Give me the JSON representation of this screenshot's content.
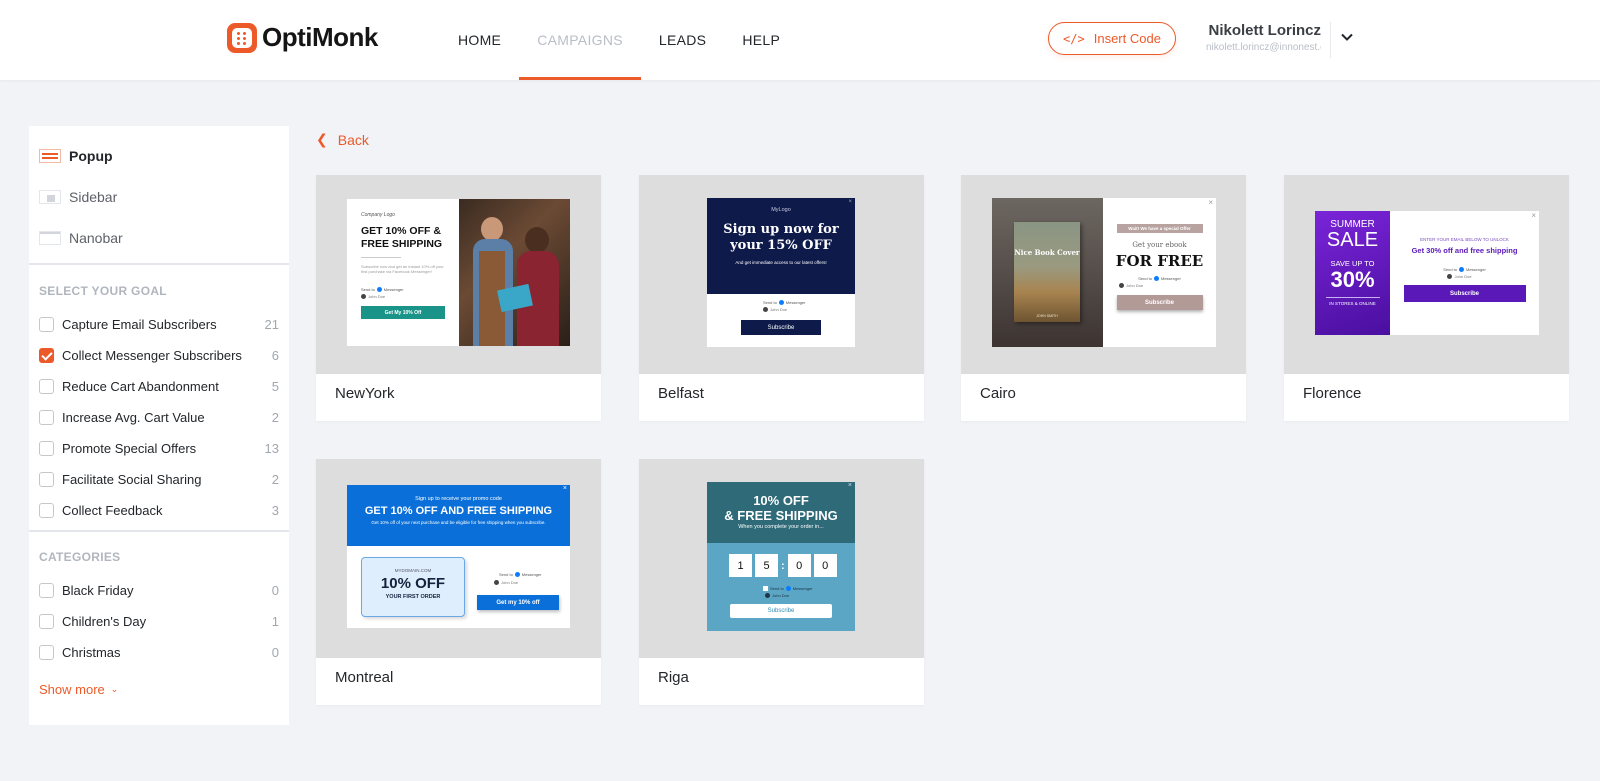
{
  "header": {
    "logo_text": "OptiMonk",
    "nav": [
      {
        "label": "HOME",
        "active": false
      },
      {
        "label": "CAMPAIGNS",
        "active": true
      },
      {
        "label": "LEADS",
        "active": false
      },
      {
        "label": "HELP",
        "active": false
      }
    ],
    "insert_code_label": "Insert Code",
    "user_name": "Nikolett Lorincz",
    "user_email": "nikolett.lorincz@innonest.com"
  },
  "sidebar": {
    "types": [
      {
        "label": "Popup",
        "active": true
      },
      {
        "label": "Sidebar",
        "active": false
      },
      {
        "label": "Nanobar",
        "active": false
      }
    ],
    "goal_title": "SELECT YOUR GOAL",
    "goals": [
      {
        "label": "Capture Email Subscribers",
        "count": "21",
        "checked": false
      },
      {
        "label": "Collect Messenger Subscribers",
        "count": "6",
        "checked": true
      },
      {
        "label": "Reduce Cart Abandonment",
        "count": "5",
        "checked": false
      },
      {
        "label": "Increase Avg. Cart Value",
        "count": "2",
        "checked": false
      },
      {
        "label": "Promote Special Offers",
        "count": "13",
        "checked": false
      },
      {
        "label": "Facilitate Social Sharing",
        "count": "2",
        "checked": false
      },
      {
        "label": "Collect Feedback",
        "count": "3",
        "checked": false
      }
    ],
    "categories_title": "CATEGORIES",
    "categories": [
      {
        "label": "Black Friday",
        "count": "0",
        "checked": false
      },
      {
        "label": "Children's Day",
        "count": "1",
        "checked": false
      },
      {
        "label": "Christmas",
        "count": "0",
        "checked": false
      }
    ],
    "show_more": "Show more"
  },
  "main": {
    "back_label": "Back",
    "templates": [
      {
        "name": "NewYork"
      },
      {
        "name": "Belfast"
      },
      {
        "name": "Cairo"
      },
      {
        "name": "Florence"
      },
      {
        "name": "Montreal"
      },
      {
        "name": "Riga"
      }
    ]
  },
  "previews": {
    "newyork": {
      "logo": "Company Logo",
      "headline": "GET 10% OFF & FREE SHIPPING",
      "body": "Subscribe now and get an instant 10% off your first purchase via Facebook Messenger!",
      "send_to": "Send to",
      "messenger": "Messenger",
      "user": "John Doe",
      "cta": "Get My 10% Off"
    },
    "belfast": {
      "logo": "MyLogo",
      "headline": "Sign up now for your 15% OFF",
      "sub": "And get immediate access to our latest offers!",
      "send_to": "Send to",
      "messenger": "Messenger",
      "user": "John Doe",
      "cta": "Subscribe"
    },
    "cairo": {
      "book_title": "Nice Book Cover",
      "author": "JOHN SMITH",
      "tag": "Wait! We have a special Offer",
      "line1": "Get your ebook",
      "line2": "FOR FREE",
      "send_to": "Send to",
      "messenger": "Messenger",
      "user": "John Doe",
      "cta": "Subscribe"
    },
    "florence": {
      "summer": "SUMMER",
      "sale": "SALE",
      "save": "SAVE UP TO",
      "pct": "30%",
      "stores": "IN STORES & ONLINE",
      "unlock": "ENTER YOUR EMAIL BELOW TO UNLOCK",
      "offer": "Get 30% off and free shipping",
      "send_to": "Send to",
      "messenger": "Messenger",
      "user": "John Doe",
      "cta": "Subscribe"
    },
    "montreal": {
      "top": "Sign up to receive your promo code",
      "headline": "GET 10% OFF AND FREE SHIPPING",
      "sub": "Get 10% off of your next purchase and be eligible for free shipping when you subscribe.",
      "domain": "MYDOMAIN.COM",
      "big": "10% OFF",
      "first": "YOUR FIRST ORDER",
      "send_to": "Send to",
      "messenger": "Messenger",
      "user": "John Doe",
      "cta": "Get my 10% off"
    },
    "riga": {
      "line1": "10% OFF",
      "line2": "& FREE SHIPPING",
      "line3": "When you complete your order in...",
      "d1": "1",
      "d2": "5",
      "d3": "0",
      "d4": "0",
      "send_to": "Send to",
      "messenger": "Messenger",
      "user": "John Doe",
      "cta": "Subscribe"
    }
  },
  "colors": {
    "accent": "#ed5a29",
    "page_bg": "#f1f3f7",
    "belfast_navy": "#0d1a4a",
    "florence_purple": "#5a18b8",
    "montreal_blue": "#0a6fd8",
    "riga_teal": "#2e6a77",
    "newyork_teal": "#1a9488"
  }
}
